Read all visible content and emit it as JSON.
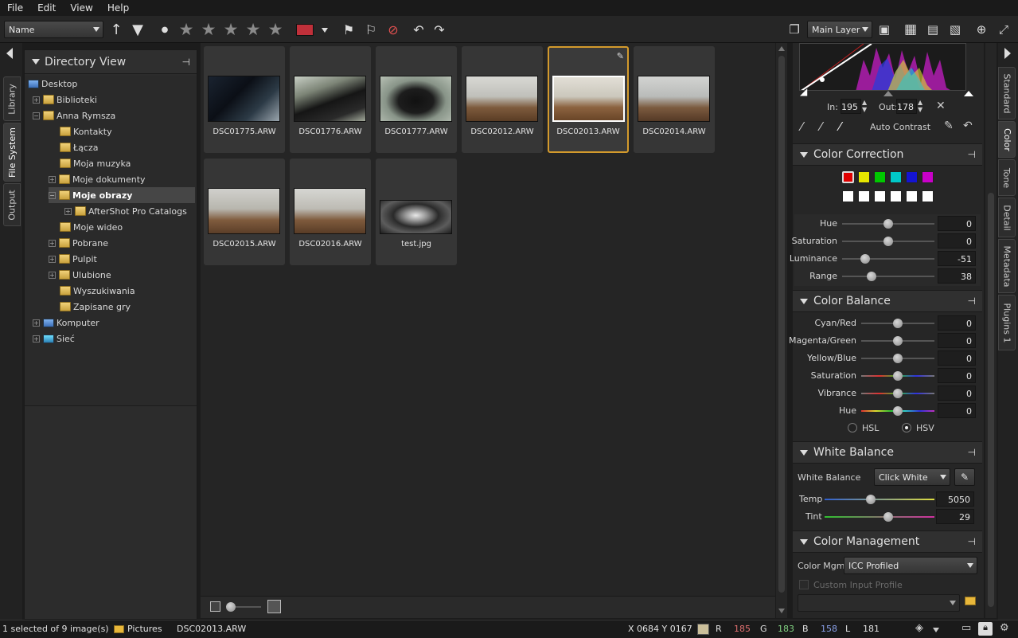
{
  "menu": [
    "File",
    "Edit",
    "View",
    "Help"
  ],
  "toolbar": {
    "sort_value": "Name",
    "layer_value": "Main Layer"
  },
  "left_tabs": [
    "Library",
    "File System",
    "Output"
  ],
  "directory": {
    "title": "Directory View",
    "items": [
      "Desktop",
      "Biblioteki",
      "Anna Rymsza",
      "Kontakty",
      "Łącza",
      "Moja muzyka",
      "Moje dokumenty",
      "Moje obrazy",
      "AfterShot Pro Catalogs",
      "Moje wideo",
      "Pobrane",
      "Pulpit",
      "Ulubione",
      "Wyszukiwania",
      "Zapisane gry",
      "Komputer",
      "Sieć"
    ]
  },
  "thumbs": [
    "DSC01775.ARW",
    "DSC01776.ARW",
    "DSC01777.ARW",
    "DSC02012.ARW",
    "DSC02013.ARW",
    "DSC02014.ARW",
    "DSC02015.ARW",
    "DSC02016.ARW",
    "test.jpg"
  ],
  "curve": {
    "in_label": "In:",
    "in_value": "195",
    "out_label": "Out:",
    "out_value": "178",
    "auto_contrast": "Auto Contrast"
  },
  "color_correction": {
    "title": "Color Correction",
    "swatches": [
      "#e00000",
      "#e6e600",
      "#00c800",
      "#00c8c8",
      "#1414d2",
      "#c800c8"
    ],
    "sliders": [
      {
        "label": "Hue",
        "value": "0",
        "pos": 0.5
      },
      {
        "label": "Saturation",
        "value": "0",
        "pos": 0.5
      },
      {
        "label": "Luminance",
        "value": "-51",
        "pos": 0.25
      },
      {
        "label": "Range",
        "value": "38",
        "pos": 0.32
      }
    ]
  },
  "color_balance": {
    "title": "Color Balance",
    "sliders": [
      {
        "label": "Cyan/Red",
        "value": "0",
        "pos": 0.5
      },
      {
        "label": "Magenta/Green",
        "value": "0",
        "pos": 0.5
      },
      {
        "label": "Yellow/Blue",
        "value": "0",
        "pos": 0.5
      },
      {
        "label": "Saturation",
        "value": "0",
        "pos": 0.5
      },
      {
        "label": "Vibrance",
        "value": "0",
        "pos": 0.5
      },
      {
        "label": "Hue",
        "value": "0",
        "pos": 0.5
      }
    ],
    "hsl": "HSL",
    "hsv": "HSV"
  },
  "white_balance": {
    "title": "White Balance",
    "label": "White Balance",
    "mode": "Click White",
    "temp_label": "Temp",
    "temp_value": "5050",
    "temp_pos": 0.42,
    "tint_label": "Tint",
    "tint_value": "29",
    "tint_pos": 0.58
  },
  "color_management": {
    "title": "Color Management",
    "label": "Color Mgmt",
    "value": "ICC Profiled",
    "custom": "Custom Input Profile"
  },
  "right_tabs": [
    "Standard",
    "Color",
    "Tone",
    "Detail",
    "Metadata",
    "Plugins 1"
  ],
  "status": {
    "selection": "1 selected of 9 image(s)",
    "folder": "Pictures",
    "file": "DSC02013.ARW",
    "coords": "X 0684  Y 0167",
    "r_label": "R",
    "r": "185",
    "g_label": "G",
    "g": "183",
    "b_label": "B",
    "b": "158",
    "l_label": "L",
    "l": "181"
  }
}
